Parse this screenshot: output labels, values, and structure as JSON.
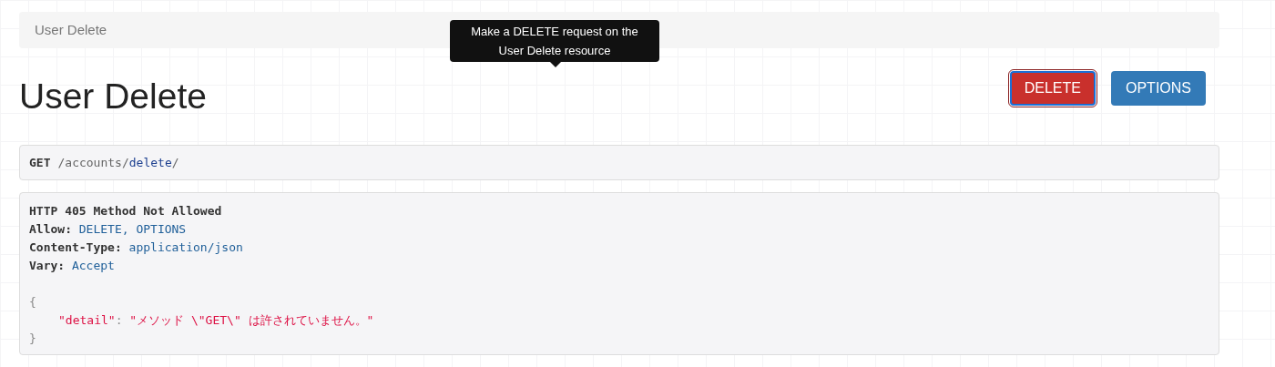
{
  "breadcrumb": "User Delete",
  "tooltip": {
    "text": "Make a DELETE request on the User Delete resource"
  },
  "title": "User Delete",
  "buttons": [
    {
      "label": "DELETE",
      "kind": "danger",
      "focused": true
    },
    {
      "label": "OPTIONS",
      "kind": "primary",
      "focused": false
    }
  ],
  "request": {
    "method": "GET",
    "path": [
      {
        "text": "/accounts/",
        "kind": "plain"
      },
      {
        "text": "delete",
        "kind": "link"
      },
      {
        "text": "/",
        "kind": "plain"
      }
    ]
  },
  "response": {
    "status": "HTTP 405 Method Not Allowed",
    "headers": [
      {
        "name": "Allow:",
        "value": "DELETE, OPTIONS"
      },
      {
        "name": "Content-Type:",
        "value": "application/json"
      },
      {
        "name": "Vary:",
        "value": "Accept"
      }
    ],
    "body": {
      "open": "{",
      "entries": [
        {
          "key": "\"detail\"",
          "separator": ":",
          "value": "\"メソッド \\\"GET\\\" は許されていません。\""
        }
      ],
      "close": "}"
    }
  }
}
